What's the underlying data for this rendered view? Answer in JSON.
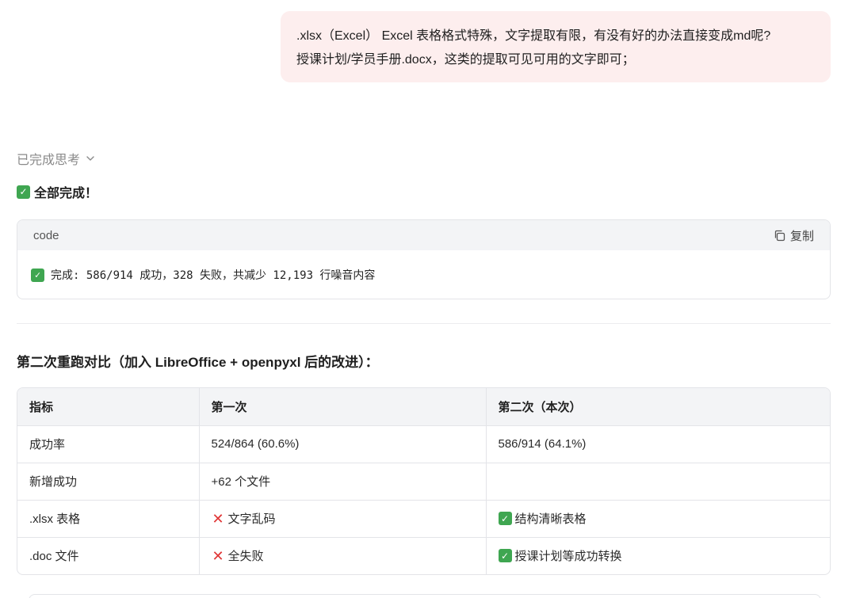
{
  "user_message": {
    "line1": ".xlsx（Excel） Excel 表格格式特殊，文字提取有限，有没有好的办法直接变成md呢?",
    "line2": "授课计划/学员手册.docx，这类的提取可见可用的文字即可；"
  },
  "thinking_toggle": {
    "label": "已完成思考",
    "icon": "chevron-down-icon"
  },
  "done_line": {
    "icon": "check-mark-button-icon",
    "text": "全部完成！"
  },
  "code_block": {
    "language": "code",
    "copy_label": "复制",
    "copy_icon": "copy-icon",
    "content_icon": "check-mark-button-icon",
    "content": "完成: 586/914 成功，328 失败，共减少 12,193 行噪音内容"
  },
  "section_heading": "第二次重跑对比（加入 LibreOffice + openpyxl 后的改进）：",
  "comparison_table": {
    "headers": [
      "指标",
      "第一次",
      "第二次（本次）"
    ],
    "rows": [
      {
        "metric": "成功率",
        "first": {
          "icon": "",
          "text": "524/864 (60.6%)"
        },
        "second": {
          "icon": "",
          "text": "586/914 (64.1%)"
        }
      },
      {
        "metric": "新增成功",
        "first": {
          "icon": "",
          "text": "+62 个文件"
        },
        "second": {
          "icon": "",
          "text": ""
        }
      },
      {
        "metric": ".xlsx 表格",
        "first": {
          "icon": "cross-mark-icon",
          "text": "文字乱码"
        },
        "second": {
          "icon": "check-mark-button-icon",
          "text": "结构清晰表格"
        }
      },
      {
        "metric": ".doc 文件",
        "first": {
          "icon": "cross-mark-icon",
          "text": "全失败"
        },
        "second": {
          "icon": "check-mark-button-icon",
          "text": "授课计划等成功转换"
        }
      }
    ]
  },
  "colors": {
    "user_bubble_bg": "#fdeeee",
    "check_green": "#3fa651",
    "cross_red": "#e03535",
    "muted_text": "#8a8a8a",
    "header_bg": "#f3f4f6"
  }
}
